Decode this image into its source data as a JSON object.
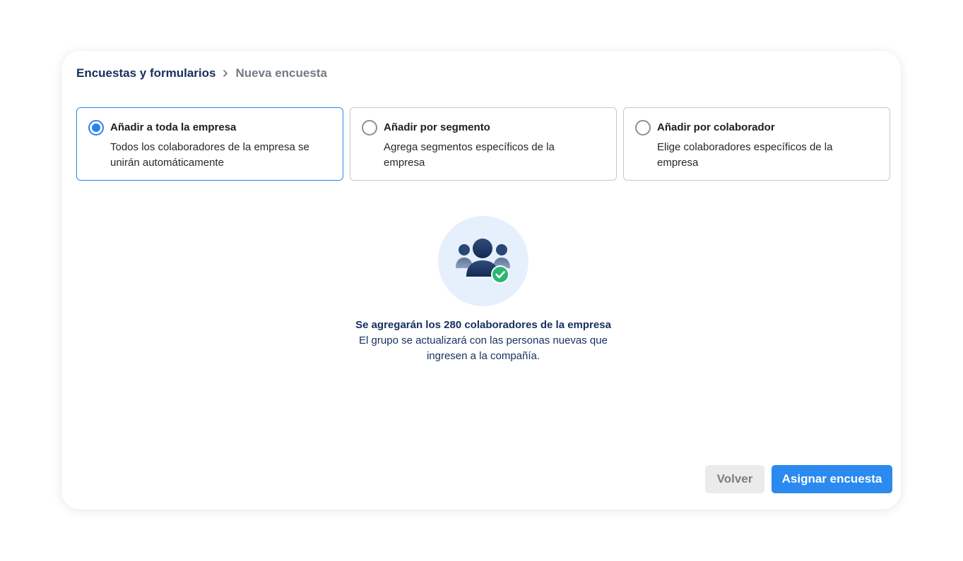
{
  "breadcrumb": {
    "parent": "Encuestas y formularios",
    "separator_icon": "chevron-right-icon",
    "current": "Nueva encuesta"
  },
  "options": [
    {
      "title": "Añadir a toda la empresa",
      "description": "Todos los colaboradores de la empresa se unirán automáticamente",
      "selected": true
    },
    {
      "title": "Añadir por segmento",
      "description": "Agrega segmentos específicos de la empresa",
      "selected": false
    },
    {
      "title": "Añadir por colaborador",
      "description": "Elige colaboradores específicos de la empresa",
      "selected": false
    }
  ],
  "illustration": {
    "icon": "users-group-check-icon"
  },
  "message": {
    "title": "Se agregarán los 280 colaboradores de la empresa",
    "description": "El grupo se actualizará con las personas nuevas que ingresen a la compañía."
  },
  "actions": {
    "back_label": "Volver",
    "submit_label": "Asignar encuesta"
  },
  "colors": {
    "accent": "#2a8aef",
    "navy": "#14305c",
    "check_green": "#2bb673",
    "illustration_bg": "#e5f0fc"
  }
}
